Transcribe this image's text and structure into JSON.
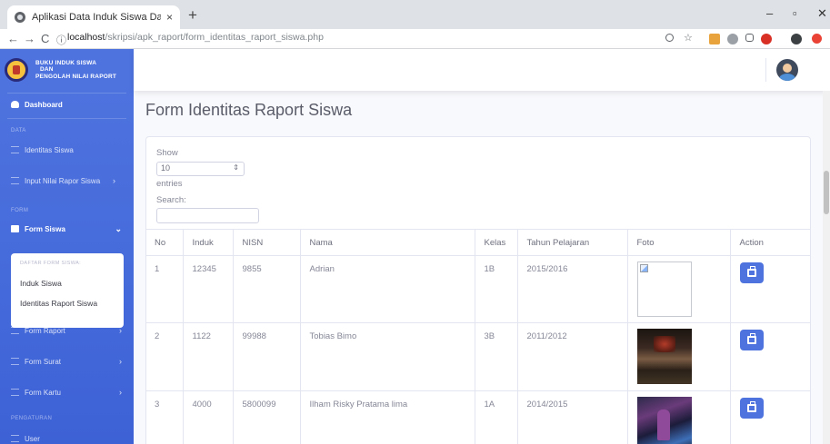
{
  "browser": {
    "tab_title": "Aplikasi Data Induk Siswa Dan N",
    "tab_close": "×",
    "new_tab": "+",
    "url_host": "localhost",
    "url_path": "/skripsi/apk_raport/form_identitas_raport_siswa.php",
    "back": "←",
    "forward": "→",
    "reload": "C",
    "info": "ⓘ",
    "minimize": "–",
    "maximize": "▫",
    "close": "✕"
  },
  "sidebar": {
    "brand_line1": "BUKU INDUK SISWA",
    "brand_line2": "DAN",
    "brand_line3": "PENGOLAH NILAI RAPORT",
    "dashboard": "Dashboard",
    "heading_data": "DATA",
    "identitas_siswa": "Identitas Siswa",
    "input_nilai": "Input Nilai Rapor Siswa",
    "heading_form": "FORM",
    "form_siswa": "Form Siswa",
    "submenu_heading": "DAFTAR FORM SISWA:",
    "submenu_induk": "Induk Siswa",
    "submenu_identitas": "Identitas Raport Siswa",
    "form_raport": "Form Raport",
    "form_surat": "Form Surat",
    "form_kartu": "Form Kartu",
    "heading_pengaturan": "PENGATURAN",
    "user": "User"
  },
  "main": {
    "page_title": "Form Identitas Raport Siswa",
    "show_label": "Show",
    "entries_value": "10",
    "entries_label": "entries",
    "search_label": "Search:",
    "columns": [
      "No",
      "Induk",
      "NISN",
      "Nama",
      "Kelas",
      "Tahun Pelajaran",
      "Foto",
      "Action"
    ],
    "rows": [
      {
        "no": "1",
        "induk": "12345",
        "nisn": "9855",
        "nama": "Adrian",
        "kelas": "1B",
        "tahun": "2015/2016"
      },
      {
        "no": "2",
        "induk": "1122",
        "nisn": "99988",
        "nama": "Tobias Bimo",
        "kelas": "3B",
        "tahun": "2011/2012"
      },
      {
        "no": "3",
        "induk": "4000",
        "nisn": "5800099",
        "nama": "Ilham Risky Pratama lima",
        "kelas": "1A",
        "tahun": "2014/2015"
      }
    ]
  },
  "colors": {
    "primary": "#4e73df",
    "sidebar_bg": "#4e73df",
    "page_bg": "#f8f9fc",
    "text_muted": "#858796"
  }
}
